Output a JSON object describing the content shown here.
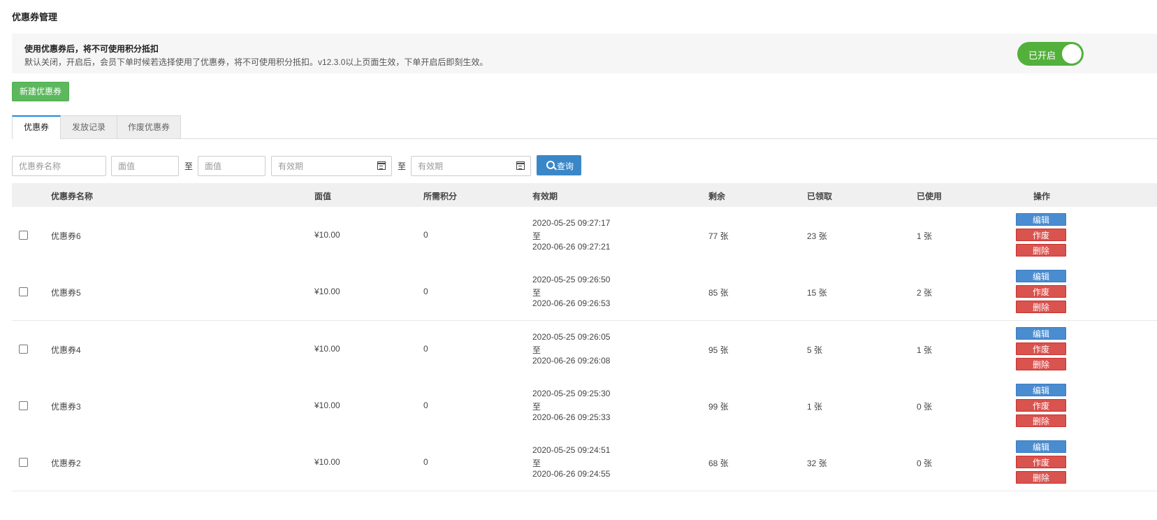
{
  "page_title": "优惠券管理",
  "notice": {
    "title": "使用优惠券后，将不可使用积分抵扣",
    "desc": "默认关闭，开启后，会员下单时候若选择使用了优惠券，将不可使用积分抵扣。v12.3.0以上页面生效，下单开启后即刻生效。",
    "toggle_label": "已开启"
  },
  "new_button": "新建优惠券",
  "tabs": [
    "优惠券",
    "发放记录",
    "作废优惠券"
  ],
  "filters": {
    "name_placeholder": "优惠券名称",
    "value_min_placeholder": "面值",
    "value_max_placeholder": "面值",
    "date_start_placeholder": "有效期",
    "date_end_placeholder": "有效期",
    "to_label": "至",
    "search_label": "查询"
  },
  "table": {
    "headers": [
      "优惠券名称",
      "面值",
      "所需积分",
      "有效期",
      "剩余",
      "已领取",
      "已使用",
      "操作"
    ],
    "rows": [
      {
        "name": "优惠券6",
        "value": "¥10.00",
        "points": "0",
        "start": "2020-05-25 09:27:17",
        "to": "至",
        "end": "2020-06-26 09:27:21",
        "remaining": "77 张",
        "received": "23 张",
        "used": "1 张"
      },
      {
        "name": "优惠券5",
        "value": "¥10.00",
        "points": "0",
        "start": "2020-05-25 09:26:50",
        "to": "至",
        "end": "2020-06-26 09:26:53",
        "remaining": "85 张",
        "received": "15 张",
        "used": "2 张"
      },
      {
        "name": "优惠券4",
        "value": "¥10.00",
        "points": "0",
        "start": "2020-05-25 09:26:05",
        "to": "至",
        "end": "2020-06-26 09:26:08",
        "remaining": "95 张",
        "received": "5 张",
        "used": "1 张"
      },
      {
        "name": "优惠券3",
        "value": "¥10.00",
        "points": "0",
        "start": "2020-05-25 09:25:30",
        "to": "至",
        "end": "2020-06-26 09:25:33",
        "remaining": "99 张",
        "received": "1 张",
        "used": "0 张"
      },
      {
        "name": "优惠券2",
        "value": "¥10.00",
        "points": "0",
        "start": "2020-05-25 09:24:51",
        "to": "至",
        "end": "2020-06-26 09:24:55",
        "remaining": "68 张",
        "received": "32 张",
        "used": "0 张"
      }
    ],
    "actions": {
      "edit": "编辑",
      "void": "作废",
      "delete": "删除"
    }
  },
  "colors": {
    "toggle_on": "#52b03b",
    "new_button": "#5cb85c",
    "primary": "#3a87c8",
    "danger": "#d9534f",
    "tab_accent": "#1e88e5"
  }
}
